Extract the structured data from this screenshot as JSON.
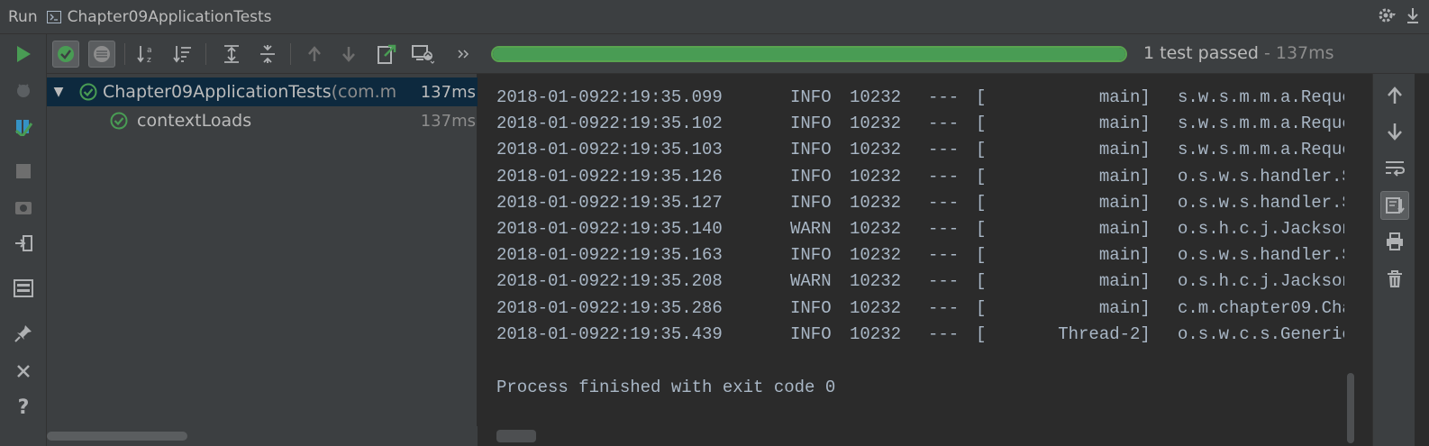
{
  "title_bar": {
    "run_label": "Run",
    "config_name": "Chapter09ApplicationTests",
    "config_icon": "run-config-icon",
    "settings_icon": "gear-icon",
    "hide_icon": "hide-icon"
  },
  "left_toolbar": {
    "items": [
      "run-icon",
      "debug-icon",
      "coverage-icon",
      "stop-icon",
      "screenshot-icon",
      "exit-icon",
      "layout-icon",
      "pin-icon",
      "close-icon",
      "help-icon"
    ]
  },
  "test_toolbar": {
    "items": [
      "show-passed-icon",
      "show-ignored-icon",
      "sort-alphabetically-icon",
      "sort-by-duration-icon",
      "expand-all-icon",
      "collapse-all-icon",
      "previous-failed-icon",
      "next-failed-icon",
      "export-icon",
      "import-icon",
      "more-icon"
    ]
  },
  "progress": {
    "fraction": 1.0,
    "status": "1 test passed",
    "separator": " - ",
    "duration": "137ms",
    "color": "#499c54"
  },
  "test_tree": {
    "nodes": [
      {
        "name": "Chapter09ApplicationTests",
        "package": " (com.m",
        "duration": "137ms",
        "status": "passed"
      },
      {
        "name": "contextLoads",
        "duration": "137ms",
        "status": "passed"
      }
    ]
  },
  "console": {
    "lines": [
      {
        "date": "2018-01-09",
        "time": "22:19:35.099",
        "level": "INFO",
        "pid": "10232",
        "sep": "---",
        "thread": "[           main]",
        "logger": "s.w.s.m.m.a.Reque"
      },
      {
        "date": "2018-01-09",
        "time": "22:19:35.102",
        "level": "INFO",
        "pid": "10232",
        "sep": "---",
        "thread": "[           main]",
        "logger": "s.w.s.m.m.a.Reque"
      },
      {
        "date": "2018-01-09",
        "time": "22:19:35.103",
        "level": "INFO",
        "pid": "10232",
        "sep": "---",
        "thread": "[           main]",
        "logger": "s.w.s.m.m.a.Reque"
      },
      {
        "date": "2018-01-09",
        "time": "22:19:35.126",
        "level": "INFO",
        "pid": "10232",
        "sep": "---",
        "thread": "[           main]",
        "logger": "o.s.w.s.handler.S"
      },
      {
        "date": "2018-01-09",
        "time": "22:19:35.127",
        "level": "INFO",
        "pid": "10232",
        "sep": "---",
        "thread": "[           main]",
        "logger": "o.s.w.s.handler.S"
      },
      {
        "date": "2018-01-09",
        "time": "22:19:35.140",
        "level": "WARN",
        "pid": "10232",
        "sep": "---",
        "thread": "[           main]",
        "logger": "o.s.h.c.j.Jackson"
      },
      {
        "date": "2018-01-09",
        "time": "22:19:35.163",
        "level": "INFO",
        "pid": "10232",
        "sep": "---",
        "thread": "[           main]",
        "logger": "o.s.w.s.handler.S"
      },
      {
        "date": "2018-01-09",
        "time": "22:19:35.208",
        "level": "WARN",
        "pid": "10232",
        "sep": "---",
        "thread": "[           main]",
        "logger": "o.s.h.c.j.Jackson"
      },
      {
        "date": "2018-01-09",
        "time": "22:19:35.286",
        "level": "INFO",
        "pid": "10232",
        "sep": "---",
        "thread": "[           main]",
        "logger": "c.m.chapter09.Cha"
      },
      {
        "date": "2018-01-09",
        "time": "22:19:35.439",
        "level": "INFO",
        "pid": "10232",
        "sep": "---",
        "thread": "[       Thread-2]",
        "logger": "o.s.w.c.s.Generic"
      }
    ],
    "finish_message": "Process finished with exit code 0"
  },
  "right_toolbar": {
    "items": [
      "up-arrow-icon",
      "down-arrow-icon",
      "soft-wrap-icon",
      "scroll-to-end-icon",
      "print-icon",
      "trash-icon"
    ]
  }
}
